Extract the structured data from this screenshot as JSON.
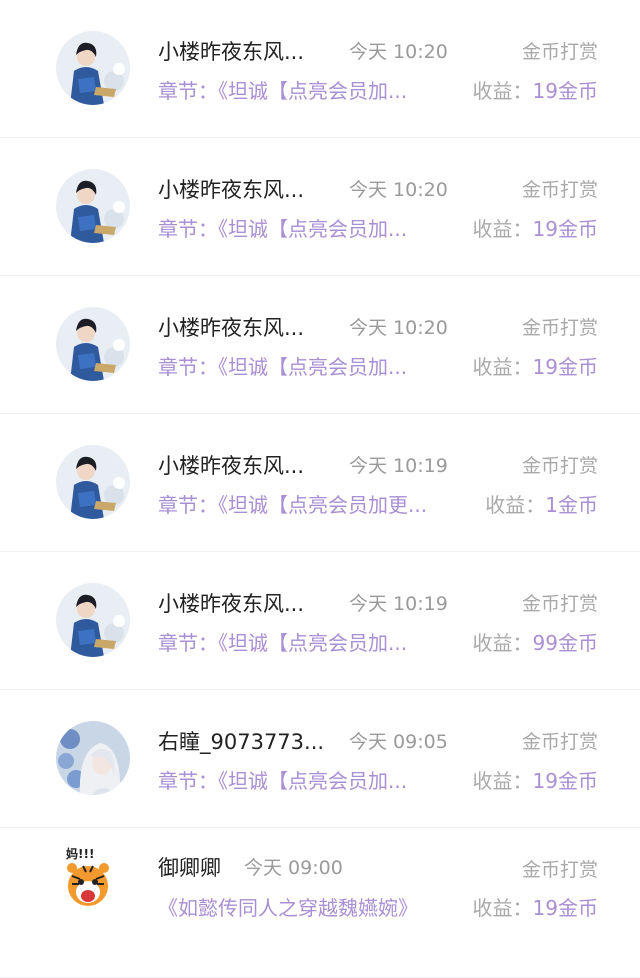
{
  "records": [
    {
      "avatar": "man-in-blue-robe-avatar",
      "name": "小楼昨夜东风...",
      "time": "今天 10:20",
      "type": "金币打赏",
      "chapter": "章节：《坦诚【点亮会员加...",
      "income_label": "收益：",
      "income_value": "19金币"
    },
    {
      "avatar": "man-in-blue-robe-avatar",
      "name": "小楼昨夜东风...",
      "time": "今天 10:20",
      "type": "金币打赏",
      "chapter": "章节：《坦诚【点亮会员加...",
      "income_label": "收益：",
      "income_value": "19金币"
    },
    {
      "avatar": "man-in-blue-robe-avatar",
      "name": "小楼昨夜东风...",
      "time": "今天 10:20",
      "type": "金币打赏",
      "chapter": "章节：《坦诚【点亮会员加...",
      "income_label": "收益：",
      "income_value": "19金币"
    },
    {
      "avatar": "man-in-blue-robe-avatar",
      "name": "小楼昨夜东风...",
      "time": "今天 10:19",
      "type": "金币打赏",
      "chapter": "章节：《坦诚【点亮会员加更...",
      "income_label": "收益：",
      "income_value": "1金币"
    },
    {
      "avatar": "man-in-blue-robe-avatar",
      "name": "小楼昨夜东风...",
      "time": "今天 10:19",
      "type": "金币打赏",
      "chapter": "章节：《坦诚【点亮会员加...",
      "income_label": "收益：",
      "income_value": "99金币"
    },
    {
      "avatar": "white-haired-girl-avatar",
      "name": "右瞳_9073773...",
      "time": "今天 09:05",
      "type": "金币打赏",
      "chapter": "章节：《坦诚【点亮会员加...",
      "income_label": "收益：",
      "income_value": "19金币"
    },
    {
      "avatar": "cartoon-tiger-avatar",
      "avatar_caption": "妈!!!",
      "name": "御卿卿",
      "time": "今天 09:00",
      "type": "金币打赏",
      "chapter": "《如懿传同人之穿越魏嬿婉》",
      "income_label": "收益：",
      "income_value": "19金币"
    }
  ],
  "colors": {
    "accent_purple": "#a98fd3",
    "muted_gray": "#a9a9a9",
    "name_text": "#222222",
    "divider": "#f0f0f2"
  }
}
